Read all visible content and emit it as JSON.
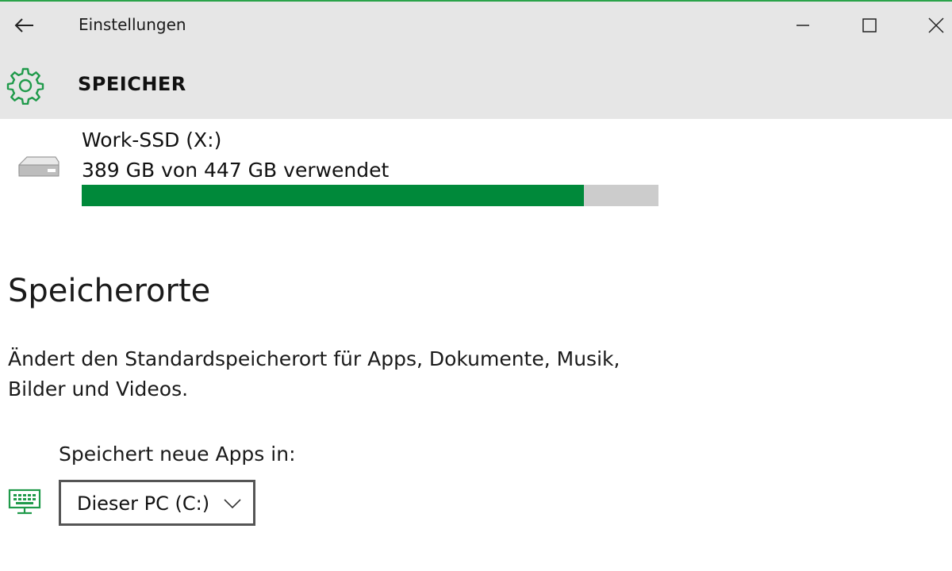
{
  "window": {
    "title": "Einstellungen",
    "accent_color": "#2aa34a"
  },
  "header": {
    "icon": "gear-icon",
    "title": "SPEICHER",
    "icon_color": "#1f9a4a"
  },
  "drive": {
    "icon": "drive-icon",
    "name": "Work-SSD (X:)",
    "usage_text": "389 GB von 447 GB verwendet",
    "used_gb": 389,
    "total_gb": 447,
    "bar_color": "#00893a",
    "bar_track_color": "#cccccc"
  },
  "locations": {
    "title": "Speicherorte",
    "description": "Ändert den Standardspeicherort für Apps, Dokumente, Musik, Bilder und Videos.",
    "apps_label": "Speichert neue Apps in:",
    "apps_icon": "computer-icon",
    "apps_selected": "Dieser PC (C:)"
  }
}
